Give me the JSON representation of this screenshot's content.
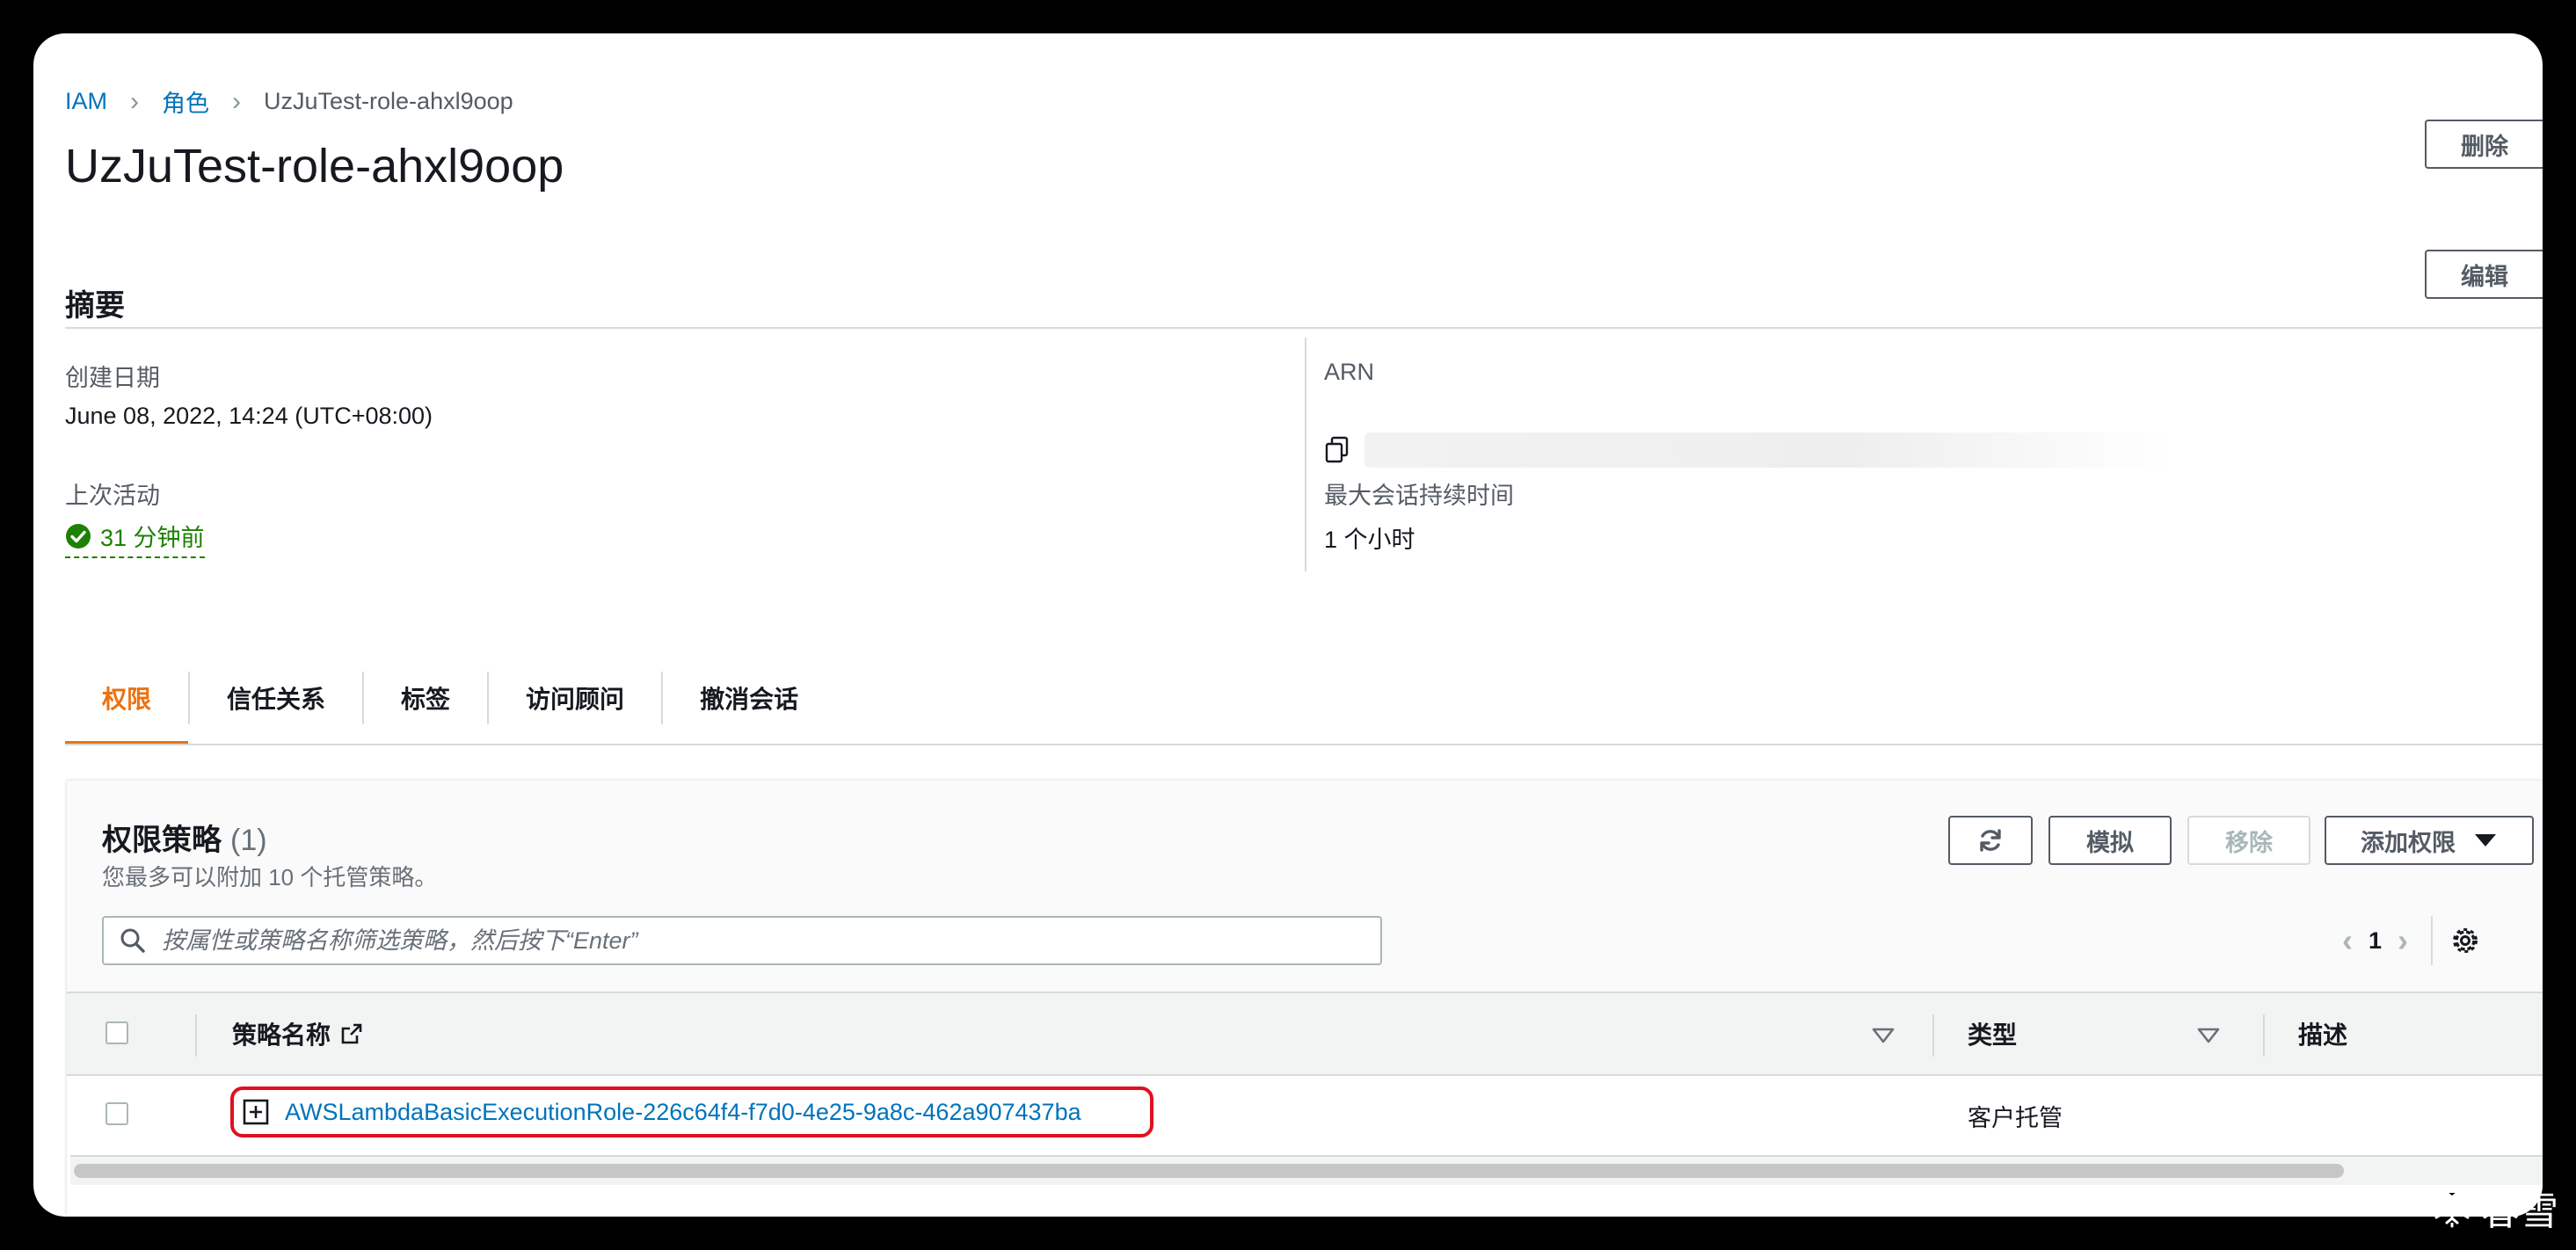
{
  "breadcrumb": {
    "root": "IAM",
    "roles": "角色",
    "current": "UzJuTest-role-ahxl9oop"
  },
  "page": {
    "title": "UzJuTest-role-ahxl9oop",
    "delete_label": "删除"
  },
  "summary": {
    "title": "摘要",
    "edit_label": "编辑",
    "created_label": "创建日期",
    "created_value": "June 08, 2022, 14:24 (UTC+08:00)",
    "last_activity_label": "上次活动",
    "last_activity_value": "31 分钟前",
    "arn_label": "ARN",
    "max_session_label": "最大会话持续时间",
    "max_session_value": "1 个小时"
  },
  "tabs": [
    {
      "label": "权限",
      "active": true
    },
    {
      "label": "信任关系",
      "active": false
    },
    {
      "label": "标签",
      "active": false
    },
    {
      "label": "访问顾问",
      "active": false
    },
    {
      "label": "撤消会话",
      "active": false
    }
  ],
  "policies": {
    "title": "权限策略",
    "count": "(1)",
    "description": "您最多可以附加 10 个托管策略。",
    "simulate_label": "模拟",
    "remove_label": "移除",
    "add_label": "添加权限",
    "search_placeholder": "按属性或策略名称筛选策略，然后按下“Enter”",
    "page_number": "1",
    "columns": {
      "name": "策略名称",
      "type": "类型",
      "description": "描述"
    },
    "rows": [
      {
        "name": "AWSLambdaBasicExecutionRole-226c64f4-f7d0-4e25-9a8c-462a907437ba",
        "type": "客户托管"
      }
    ]
  },
  "watermark": "春雪",
  "colors": {
    "link": "#0073bb",
    "active_tab": "#ec7211",
    "success": "#1d8102",
    "highlight": "#e01020"
  }
}
